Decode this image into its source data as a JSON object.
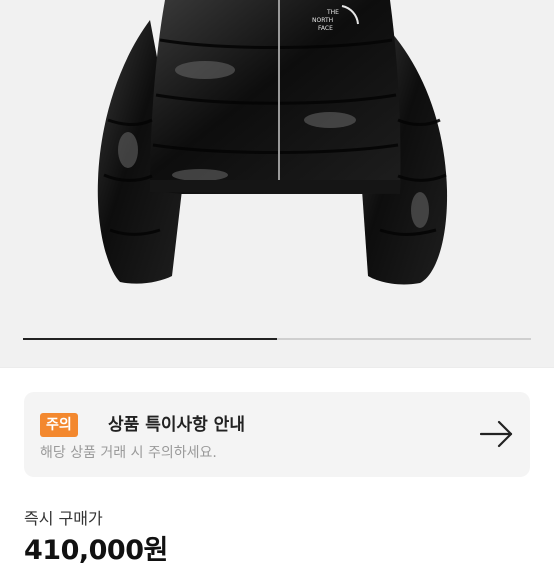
{
  "product": {
    "brand_logo_text": "THE NORTH FACE",
    "image_progress": 0.5
  },
  "notice": {
    "badge": "주의",
    "title": "상품 특이사항 안내",
    "description": "해당 상품 거래 시 주의하세요."
  },
  "price": {
    "label": "즉시 구매가",
    "value": "410,000원"
  },
  "colors": {
    "accent": "#f3882e",
    "hero_background": "#f1f1f1",
    "notice_background": "#f4f4f4"
  },
  "icons": {
    "notice_action": "arrow-right-icon"
  }
}
